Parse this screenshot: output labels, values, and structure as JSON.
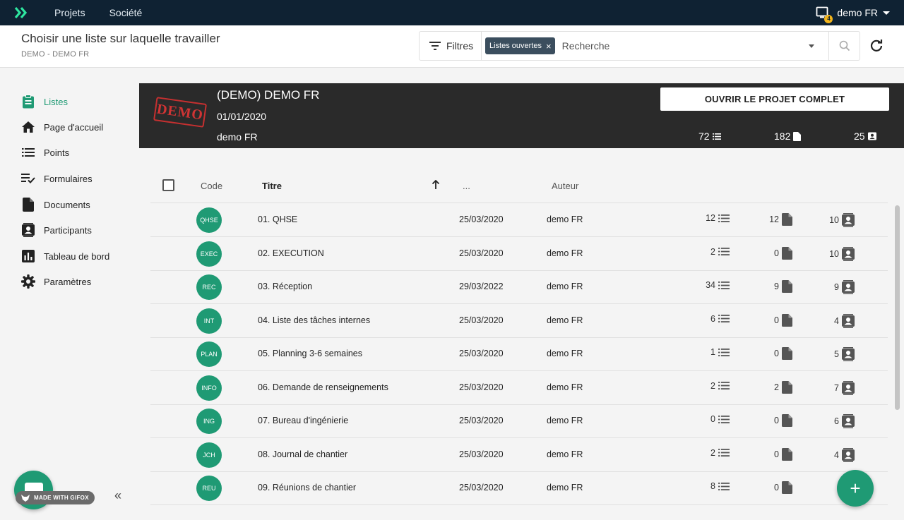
{
  "topnav": {
    "links": [
      "Projets",
      "Société"
    ],
    "user_name": "demo FR",
    "notification_count": "4"
  },
  "header": {
    "title": "Choisir une liste sur laquelle travailler",
    "subtitle": "DEMO - DEMO FR",
    "filters_label": "Filtres",
    "chip_label": "Listes ouvertes",
    "chip_close": "×",
    "search_placeholder": "Recherche"
  },
  "sidebar": {
    "items": [
      {
        "label": "Listes",
        "icon": "clipboard-icon",
        "active": true
      },
      {
        "label": "Page d'accueil",
        "icon": "home-icon"
      },
      {
        "label": "Points",
        "icon": "list-icon"
      },
      {
        "label": "Formulaires",
        "icon": "form-checklist-icon"
      },
      {
        "label": "Documents",
        "icon": "document-icon"
      },
      {
        "label": "Participants",
        "icon": "contact-icon"
      },
      {
        "label": "Tableau de bord",
        "icon": "chart-icon"
      },
      {
        "label": "Paramètres",
        "icon": "gear-icon"
      }
    ],
    "collapse_glyph": "«"
  },
  "project": {
    "stamp": "DEMO",
    "title": "(DEMO) DEMO FR",
    "date": "01/01/2020",
    "owner": "demo FR",
    "open_button": "OUVRIR LE PROJET COMPLET",
    "points": "72",
    "documents": "182",
    "participants": "25"
  },
  "table": {
    "headers": {
      "code": "Code",
      "titre": "Titre",
      "date": "...",
      "auteur": "Auteur"
    },
    "rows": [
      {
        "code": "QHSE",
        "title": "01. QHSE",
        "date": "25/03/2020",
        "author": "demo FR",
        "points": "12",
        "docs": "12",
        "participants": "10"
      },
      {
        "code": "EXEC",
        "title": "02. EXECUTION",
        "date": "25/03/2020",
        "author": "demo FR",
        "points": "2",
        "docs": "0",
        "participants": "10"
      },
      {
        "code": "REC",
        "title": "03. Réception",
        "date": "29/03/2022",
        "author": "demo FR",
        "points": "34",
        "docs": "9",
        "participants": "9"
      },
      {
        "code": "INT",
        "title": "04. Liste des tâches internes",
        "date": "25/03/2020",
        "author": "demo FR",
        "points": "6",
        "docs": "0",
        "participants": "4"
      },
      {
        "code": "PLAN",
        "title": "05. Planning 3-6 semaines",
        "date": "25/03/2020",
        "author": "demo FR",
        "points": "1",
        "docs": "0",
        "participants": "5"
      },
      {
        "code": "INFO",
        "title": "06. Demande de renseignements",
        "date": "25/03/2020",
        "author": "demo FR",
        "points": "2",
        "docs": "2",
        "participants": "7"
      },
      {
        "code": "ING",
        "title": "07. Bureau d'ingénierie",
        "date": "25/03/2020",
        "author": "demo FR",
        "points": "0",
        "docs": "0",
        "participants": "6"
      },
      {
        "code": "JCH",
        "title": "08. Journal de chantier",
        "date": "25/03/2020",
        "author": "demo FR",
        "points": "2",
        "docs": "0",
        "participants": "4"
      },
      {
        "code": "REU",
        "title": "09. Réunions de chantier",
        "date": "25/03/2020",
        "author": "demo FR",
        "points": "8",
        "docs": "0",
        "participants": ""
      }
    ]
  },
  "overlay": {
    "gifox_label": "MADE WITH GIFOX",
    "fab_label": "+"
  },
  "colors": {
    "accent": "#1f9a74",
    "topbar": "#0f2233",
    "banner": "#2a2a2a",
    "stamp": "#c63030"
  }
}
